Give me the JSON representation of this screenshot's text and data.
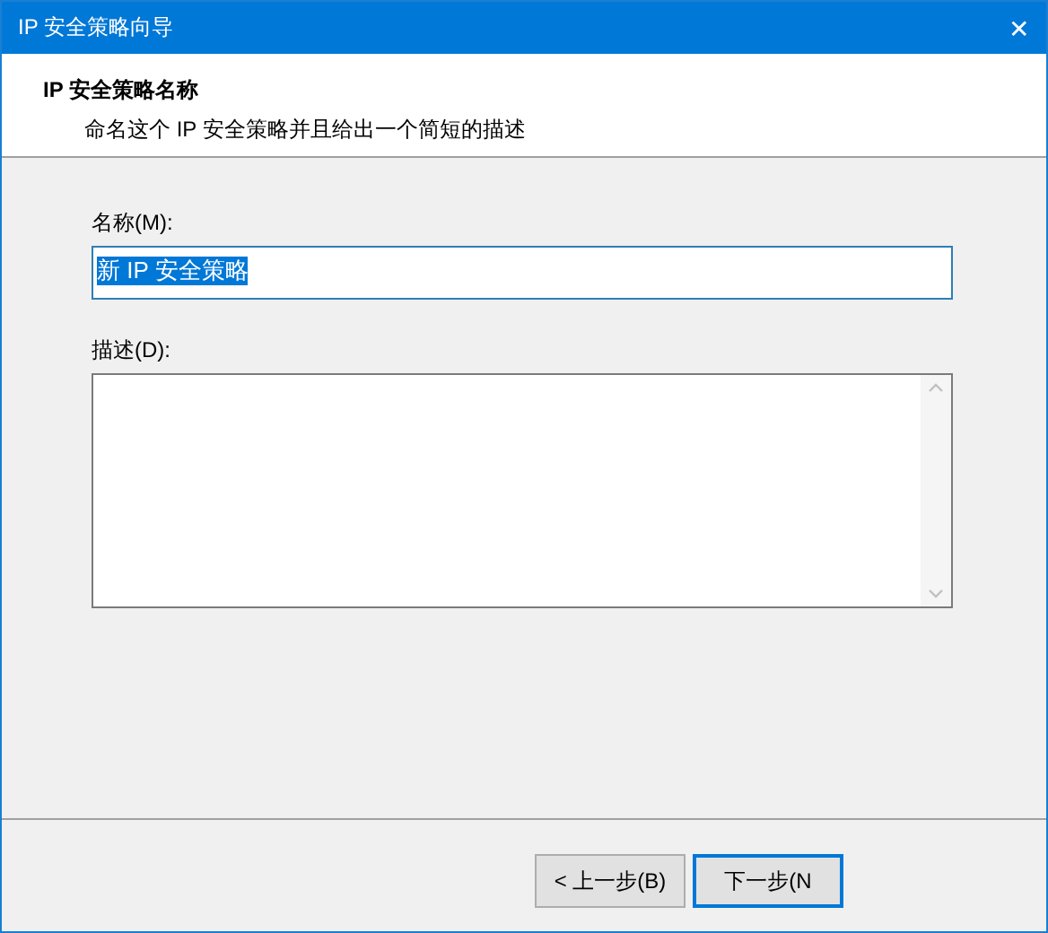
{
  "window": {
    "title": "IP 安全策略向导",
    "close": "✕"
  },
  "header": {
    "title": "IP 安全策略名称",
    "subtitle": "命名这个 IP 安全策略并且给出一个简短的描述"
  },
  "name_field": {
    "label": "名称(M):",
    "value": "新 IP 安全策略",
    "value_selected": true
  },
  "description_field": {
    "label": "描述(D):"
  },
  "buttons": [
    {
      "label": "< 上一步(B)",
      "default": false
    },
    {
      "label": "下一步(N",
      "default": true
    }
  ]
}
